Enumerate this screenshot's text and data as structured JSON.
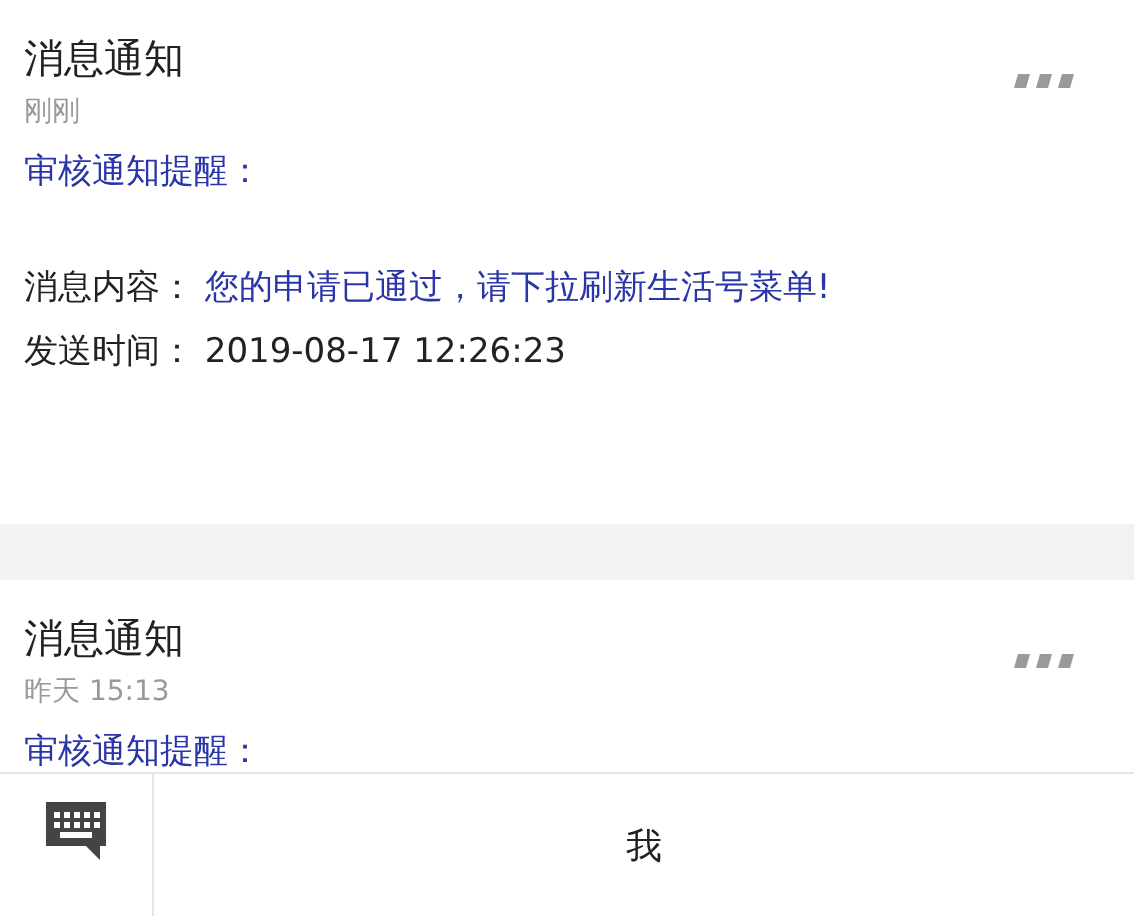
{
  "messages": [
    {
      "title": "消息通知",
      "time": "刚刚",
      "heading": "审核通知提醒：",
      "fields": [
        {
          "label": "消息内容：",
          "value": "您的申请已通过，请下拉刷新生活号菜单!",
          "kind": "link"
        },
        {
          "label": "发送时间：",
          "value": "2019-08-17 12:26:23",
          "kind": "plain"
        }
      ]
    },
    {
      "title": "消息通知",
      "time": "昨天 15:13",
      "heading": "审核通知提醒："
    }
  ],
  "bottom_bar": {
    "menus": [
      {
        "label": "我"
      }
    ]
  }
}
